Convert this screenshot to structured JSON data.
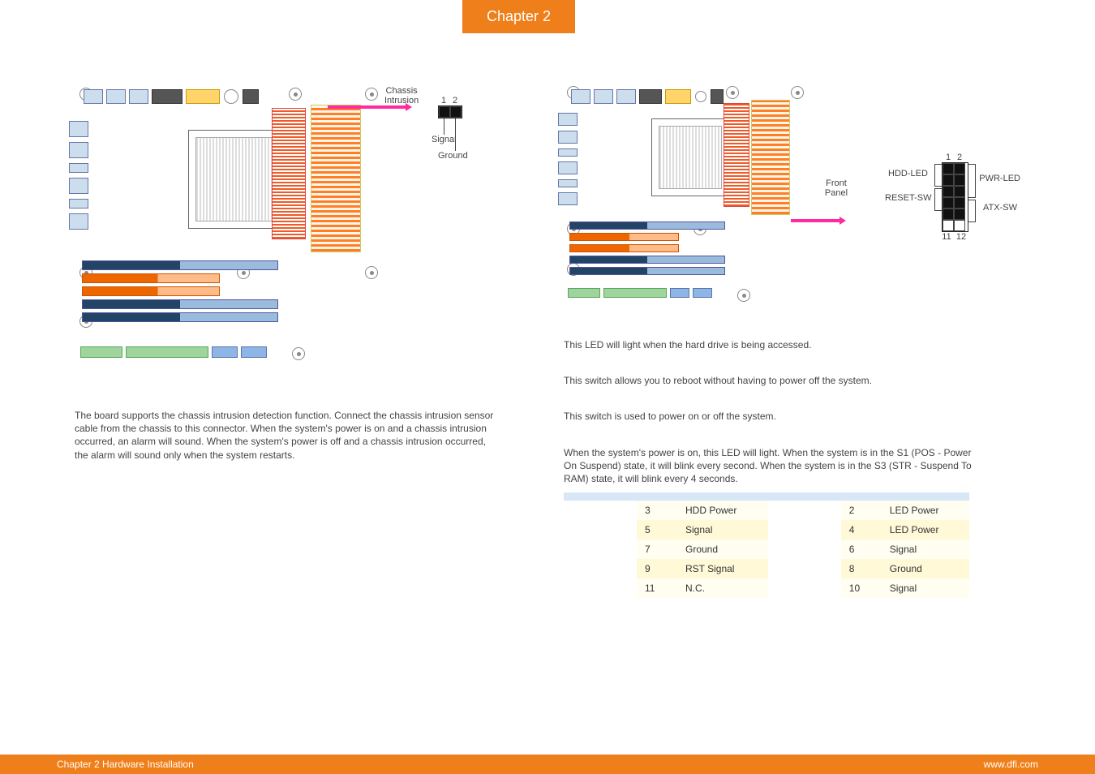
{
  "chapter_tab": "Chapter 2",
  "footer": {
    "left": "Chapter 2 Hardware Installation",
    "right": "www.dfi.com"
  },
  "left": {
    "diagram_callouts": {
      "chassis_intrusion": "Chassis Intrusion",
      "pin1": "1",
      "pin2": "2",
      "signal": "Signal",
      "ground": "Ground"
    },
    "paragraph": "The board supports the chassis intrusion detection function. Connect the chassis intrusion sensor cable from the chassis to this connector. When the system's power is on and a chassis intrusion occurred, an alarm will sound. When the system's power is off and a chassis intrusion occurred, the alarm will sound only when the system restarts."
  },
  "right": {
    "callouts": {
      "front_panel": "Front Panel",
      "hdd_led": "HDD-LED",
      "reset_sw": "RESET-SW",
      "pwr_led": "PWR-LED",
      "atx_sw": "ATX-SW",
      "top1": "1",
      "top2": "2",
      "bot1": "11",
      "bot2": "12"
    },
    "hdd_led_text": "This LED will light when the hard drive is being accessed.",
    "reset_text": "This switch allows you to reboot without having to power off the system.",
    "atx_text": "This switch is used to power on or off the system.",
    "pwr_led_text": "When the system's power is on, this LED will light. When the system is in the S1 (POS - Power On Suspend) state, it will blink every second. When the system is in the S3 (STR - Suspend To RAM) state, it will blink every 4 seconds.",
    "table": {
      "left_rows": [
        {
          "pin": "3",
          "assign": "HDD Power"
        },
        {
          "pin": "5",
          "assign": "Signal"
        },
        {
          "pin": "7",
          "assign": "Ground"
        },
        {
          "pin": "9",
          "assign": "RST Signal"
        },
        {
          "pin": "11",
          "assign": "N.C."
        }
      ],
      "right_rows": [
        {
          "pin": "2",
          "assign": "LED Power"
        },
        {
          "pin": "4",
          "assign": "LED Power"
        },
        {
          "pin": "6",
          "assign": "Signal"
        },
        {
          "pin": "8",
          "assign": "Ground"
        },
        {
          "pin": "10",
          "assign": "Signal"
        }
      ]
    }
  }
}
